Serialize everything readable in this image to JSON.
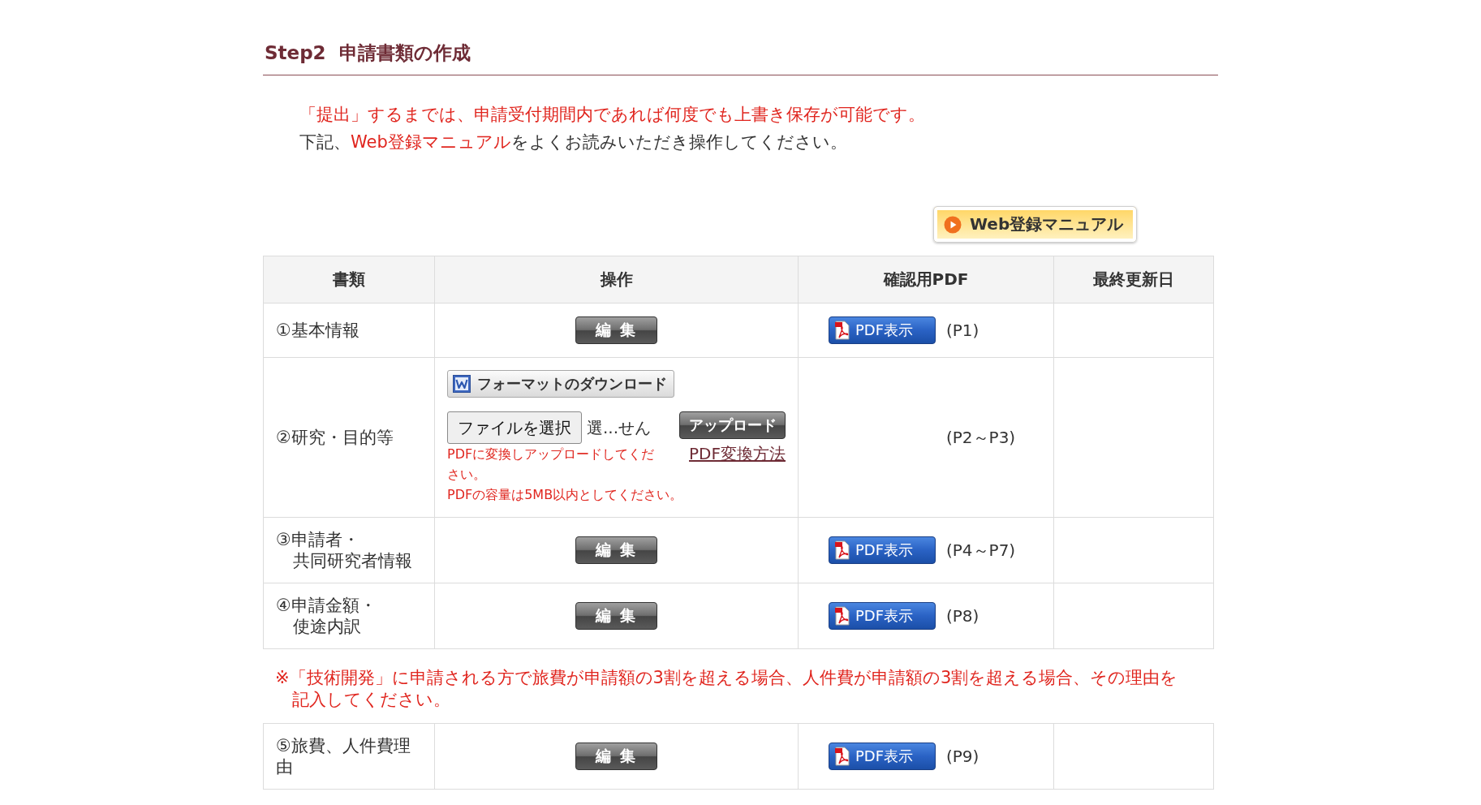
{
  "section": {
    "step": "Step2",
    "title": "申請書類の作成"
  },
  "notice": "「提出」するまでは、申請受付期間内であれば何度でも上書き保存が可能です。",
  "instruction": {
    "before": "下記、",
    "highlight": "Web登録マニュアル",
    "after": "をよくお読みいただき操作してください。"
  },
  "manual_button": {
    "label": "Web登録マニュアル"
  },
  "table": {
    "columns": [
      "書類",
      "操作",
      "確認用PDF",
      "最終更新日"
    ],
    "rows": [
      {
        "document": [
          "①基本情報"
        ],
        "action": {
          "kind": "edit",
          "label": "編 集"
        },
        "pdf": {
          "button": "PDF表示",
          "pages": "(P1)"
        }
      },
      {
        "document": [
          "②研究・目的等"
        ],
        "action": {
          "kind": "upload",
          "download_button": "フォーマットのダウンロード",
          "file_button": "ファイルを選択",
          "file_status": "選...せん",
          "upload_button": "アップロード",
          "hint": "PDFに変換しアップロードしてください。",
          "help_link": "PDF変換方法",
          "size_note": "PDFの容量は5MB以内としてください。"
        },
        "pdf": {
          "pages": "(P2～P3)"
        }
      },
      {
        "document": [
          "③申請者・",
          "共同研究者情報"
        ],
        "action": {
          "kind": "edit",
          "label": "編 集"
        },
        "pdf": {
          "button": "PDF表示",
          "pages": "(P4～P7)"
        }
      },
      {
        "document": [
          "④申請金額・",
          "使途内訳"
        ],
        "action": {
          "kind": "edit",
          "label": "編 集"
        },
        "pdf": {
          "button": "PDF表示",
          "pages": "(P8)"
        }
      }
    ]
  },
  "note": "※「技術開発」に申請される方で旅費が申請額の3割を超える場合、人件費が申請額の3割を超える場合、その理由を記入してください。",
  "table_2": {
    "rows": [
      {
        "document": [
          "⑤旅費、人件費理由"
        ],
        "action": {
          "kind": "edit",
          "label": "編 集"
        },
        "pdf": {
          "button": "PDF表示",
          "pages": "(P9)"
        }
      }
    ]
  }
}
